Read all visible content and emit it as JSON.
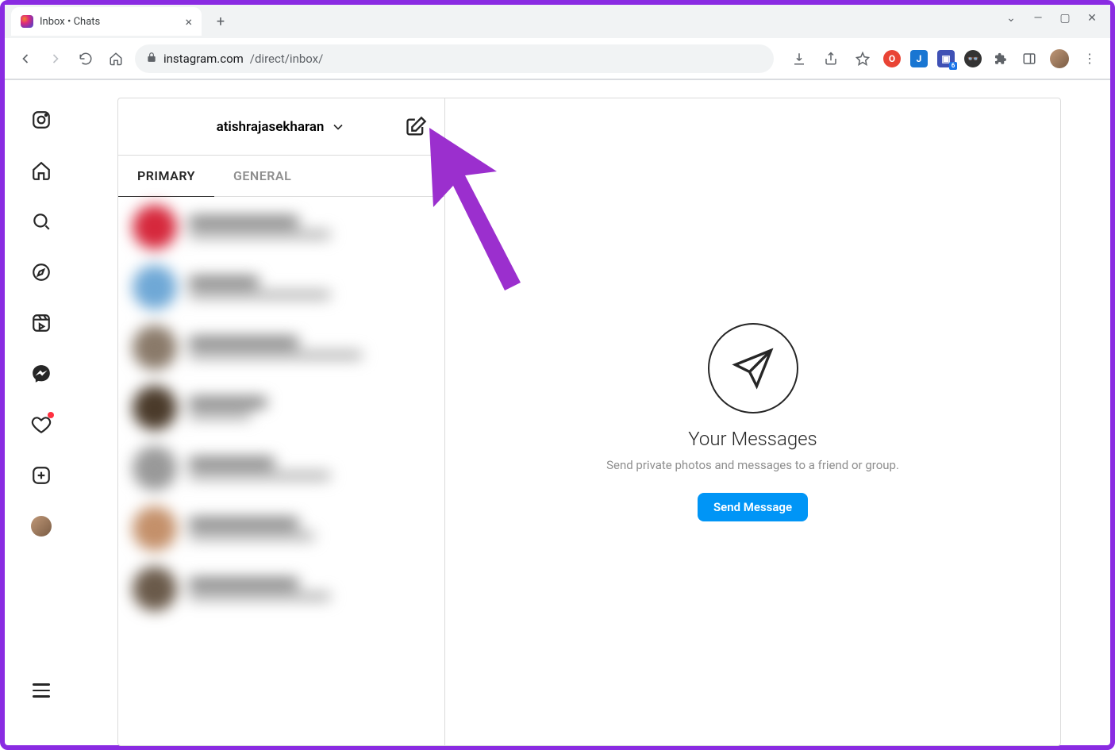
{
  "browser": {
    "tab_title": "Inbox • Chats",
    "url_prefix": "instagram.com",
    "url_path": "/direct/inbox/"
  },
  "inbox": {
    "account": "atishrajasekharan",
    "tabs": {
      "primary": "PRIMARY",
      "general": "GENERAL"
    }
  },
  "empty_state": {
    "title": "Your Messages",
    "subtitle": "Send private photos and messages to a friend or group.",
    "button": "Send Message"
  }
}
